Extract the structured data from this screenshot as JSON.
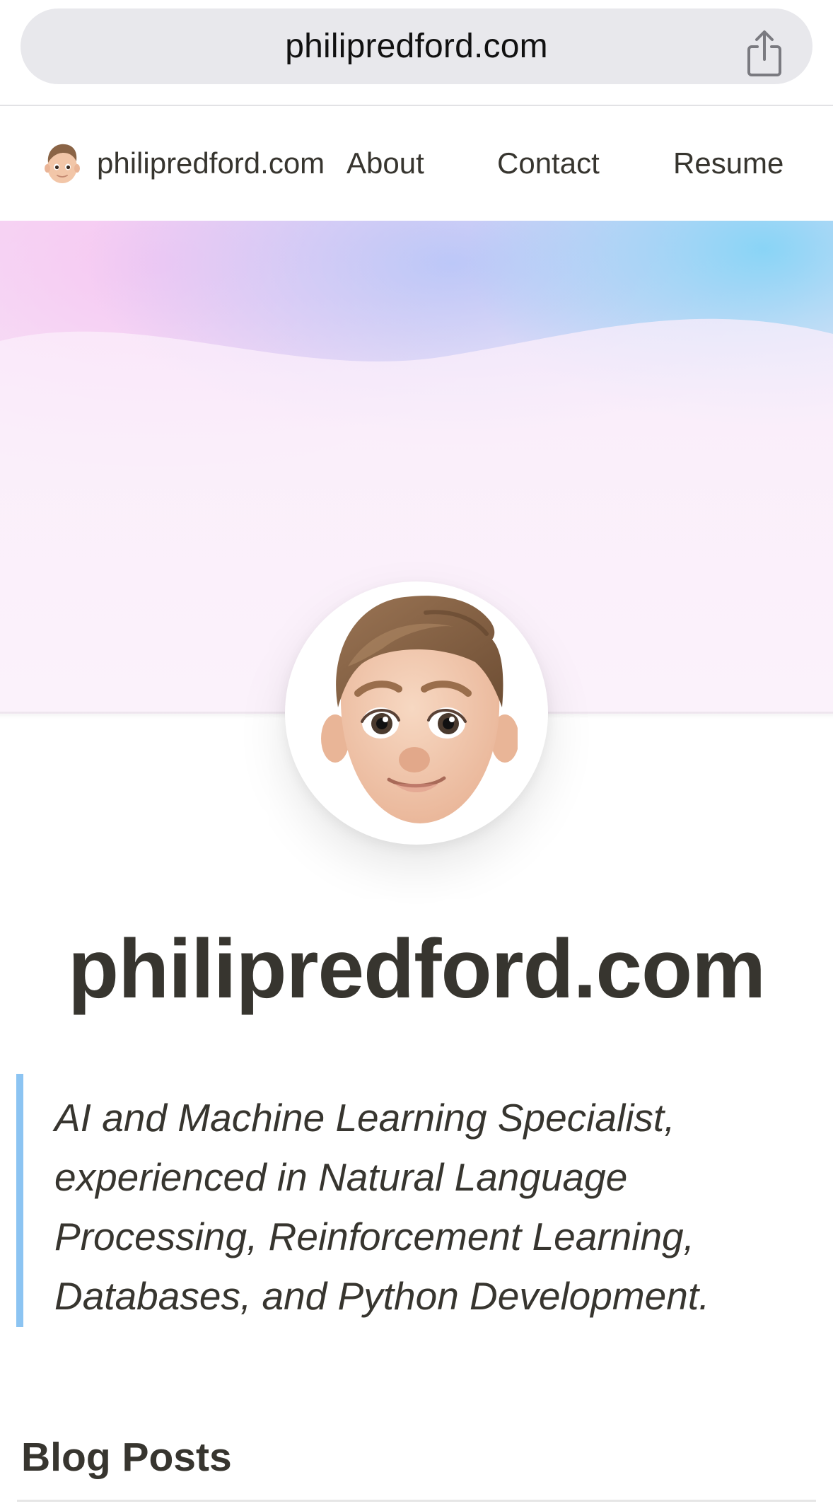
{
  "browser": {
    "url": "philipredford.com",
    "share_icon": "share-icon"
  },
  "nav": {
    "home_label": "philipredford.com",
    "about_label": "About",
    "contact_label": "Contact",
    "resume_label": "Resume",
    "avatar_icon": "memoji-avatar-icon"
  },
  "hero": {
    "avatar_icon": "memoji-avatar-icon"
  },
  "page": {
    "title": "philipredford.com",
    "quote": "AI and Machine Learning Specialist, experienced in Natural Language Processing, Reinforcement Learning, Databases, and Python Development.",
    "section_heading": "Blog Posts"
  },
  "colors": {
    "quote_accent": "#8cc4f2",
    "text": "#37352f",
    "url_bar": "#e8e8ec"
  }
}
